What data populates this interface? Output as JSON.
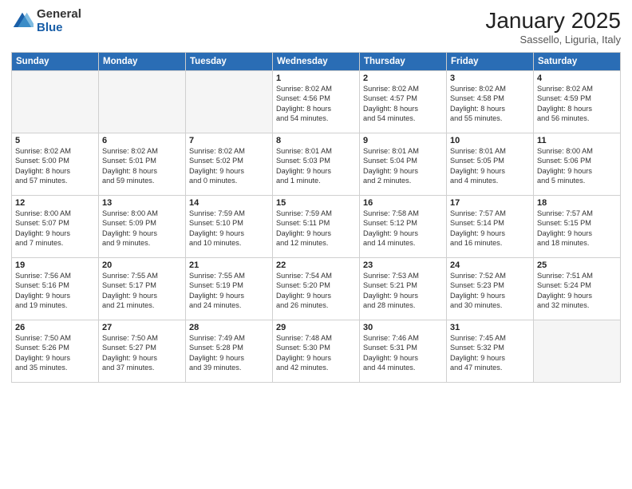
{
  "header": {
    "logo_general": "General",
    "logo_blue": "Blue",
    "month_title": "January 2025",
    "subtitle": "Sassello, Liguria, Italy"
  },
  "days_of_week": [
    "Sunday",
    "Monday",
    "Tuesday",
    "Wednesday",
    "Thursday",
    "Friday",
    "Saturday"
  ],
  "weeks": [
    [
      {
        "num": "",
        "info": ""
      },
      {
        "num": "",
        "info": ""
      },
      {
        "num": "",
        "info": ""
      },
      {
        "num": "1",
        "info": "Sunrise: 8:02 AM\nSunset: 4:56 PM\nDaylight: 8 hours\nand 54 minutes."
      },
      {
        "num": "2",
        "info": "Sunrise: 8:02 AM\nSunset: 4:57 PM\nDaylight: 8 hours\nand 54 minutes."
      },
      {
        "num": "3",
        "info": "Sunrise: 8:02 AM\nSunset: 4:58 PM\nDaylight: 8 hours\nand 55 minutes."
      },
      {
        "num": "4",
        "info": "Sunrise: 8:02 AM\nSunset: 4:59 PM\nDaylight: 8 hours\nand 56 minutes."
      }
    ],
    [
      {
        "num": "5",
        "info": "Sunrise: 8:02 AM\nSunset: 5:00 PM\nDaylight: 8 hours\nand 57 minutes."
      },
      {
        "num": "6",
        "info": "Sunrise: 8:02 AM\nSunset: 5:01 PM\nDaylight: 8 hours\nand 59 minutes."
      },
      {
        "num": "7",
        "info": "Sunrise: 8:02 AM\nSunset: 5:02 PM\nDaylight: 9 hours\nand 0 minutes."
      },
      {
        "num": "8",
        "info": "Sunrise: 8:01 AM\nSunset: 5:03 PM\nDaylight: 9 hours\nand 1 minute."
      },
      {
        "num": "9",
        "info": "Sunrise: 8:01 AM\nSunset: 5:04 PM\nDaylight: 9 hours\nand 2 minutes."
      },
      {
        "num": "10",
        "info": "Sunrise: 8:01 AM\nSunset: 5:05 PM\nDaylight: 9 hours\nand 4 minutes."
      },
      {
        "num": "11",
        "info": "Sunrise: 8:00 AM\nSunset: 5:06 PM\nDaylight: 9 hours\nand 5 minutes."
      }
    ],
    [
      {
        "num": "12",
        "info": "Sunrise: 8:00 AM\nSunset: 5:07 PM\nDaylight: 9 hours\nand 7 minutes."
      },
      {
        "num": "13",
        "info": "Sunrise: 8:00 AM\nSunset: 5:09 PM\nDaylight: 9 hours\nand 9 minutes."
      },
      {
        "num": "14",
        "info": "Sunrise: 7:59 AM\nSunset: 5:10 PM\nDaylight: 9 hours\nand 10 minutes."
      },
      {
        "num": "15",
        "info": "Sunrise: 7:59 AM\nSunset: 5:11 PM\nDaylight: 9 hours\nand 12 minutes."
      },
      {
        "num": "16",
        "info": "Sunrise: 7:58 AM\nSunset: 5:12 PM\nDaylight: 9 hours\nand 14 minutes."
      },
      {
        "num": "17",
        "info": "Sunrise: 7:57 AM\nSunset: 5:14 PM\nDaylight: 9 hours\nand 16 minutes."
      },
      {
        "num": "18",
        "info": "Sunrise: 7:57 AM\nSunset: 5:15 PM\nDaylight: 9 hours\nand 18 minutes."
      }
    ],
    [
      {
        "num": "19",
        "info": "Sunrise: 7:56 AM\nSunset: 5:16 PM\nDaylight: 9 hours\nand 19 minutes."
      },
      {
        "num": "20",
        "info": "Sunrise: 7:55 AM\nSunset: 5:17 PM\nDaylight: 9 hours\nand 21 minutes."
      },
      {
        "num": "21",
        "info": "Sunrise: 7:55 AM\nSunset: 5:19 PM\nDaylight: 9 hours\nand 24 minutes."
      },
      {
        "num": "22",
        "info": "Sunrise: 7:54 AM\nSunset: 5:20 PM\nDaylight: 9 hours\nand 26 minutes."
      },
      {
        "num": "23",
        "info": "Sunrise: 7:53 AM\nSunset: 5:21 PM\nDaylight: 9 hours\nand 28 minutes."
      },
      {
        "num": "24",
        "info": "Sunrise: 7:52 AM\nSunset: 5:23 PM\nDaylight: 9 hours\nand 30 minutes."
      },
      {
        "num": "25",
        "info": "Sunrise: 7:51 AM\nSunset: 5:24 PM\nDaylight: 9 hours\nand 32 minutes."
      }
    ],
    [
      {
        "num": "26",
        "info": "Sunrise: 7:50 AM\nSunset: 5:26 PM\nDaylight: 9 hours\nand 35 minutes."
      },
      {
        "num": "27",
        "info": "Sunrise: 7:50 AM\nSunset: 5:27 PM\nDaylight: 9 hours\nand 37 minutes."
      },
      {
        "num": "28",
        "info": "Sunrise: 7:49 AM\nSunset: 5:28 PM\nDaylight: 9 hours\nand 39 minutes."
      },
      {
        "num": "29",
        "info": "Sunrise: 7:48 AM\nSunset: 5:30 PM\nDaylight: 9 hours\nand 42 minutes."
      },
      {
        "num": "30",
        "info": "Sunrise: 7:46 AM\nSunset: 5:31 PM\nDaylight: 9 hours\nand 44 minutes."
      },
      {
        "num": "31",
        "info": "Sunrise: 7:45 AM\nSunset: 5:32 PM\nDaylight: 9 hours\nand 47 minutes."
      },
      {
        "num": "",
        "info": ""
      }
    ]
  ]
}
